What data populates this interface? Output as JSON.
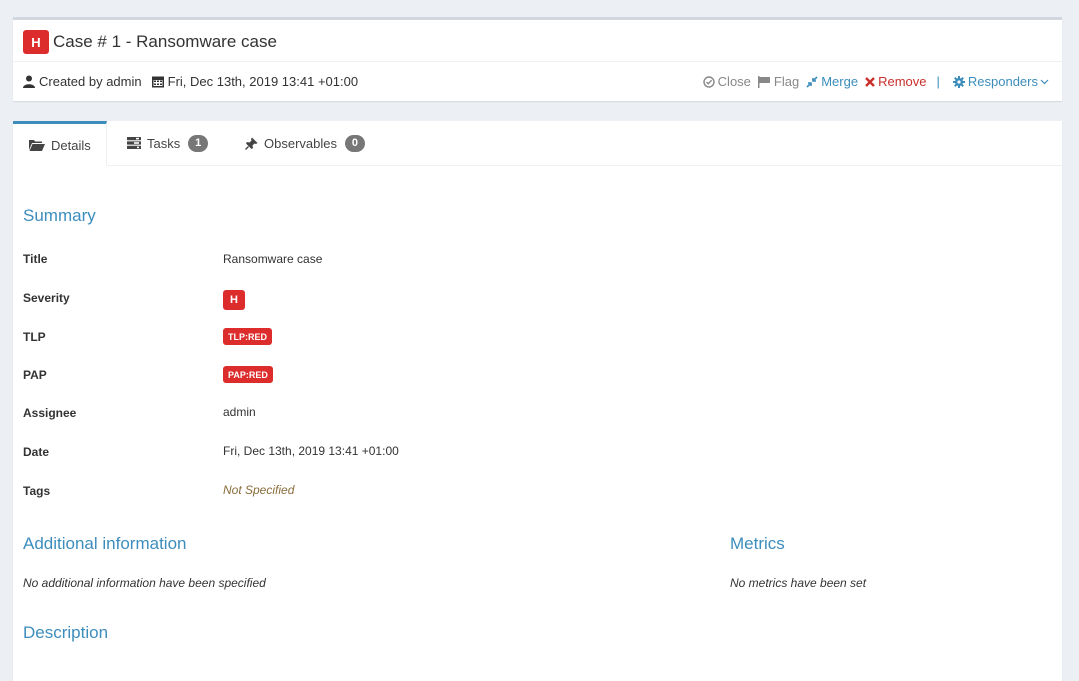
{
  "header": {
    "severity_letter": "H",
    "title": "Case # 1 - Ransomware case",
    "created_by": "Created by admin",
    "created_date": "Fri, Dec 13th, 2019 13:41 +01:00",
    "actions": {
      "close": "Close",
      "flag": "Flag",
      "merge": "Merge",
      "remove": "Remove",
      "responders": "Responders"
    }
  },
  "tabs": [
    {
      "label": "Details",
      "icon": "folder-open-icon"
    },
    {
      "label": "Tasks",
      "count": "1",
      "icon": "tasks-icon"
    },
    {
      "label": "Observables",
      "count": "0",
      "icon": "pin-icon"
    }
  ],
  "summary": {
    "heading": "Summary",
    "fields": {
      "title_label": "Title",
      "title_value": "Ransomware case",
      "severity_label": "Severity",
      "severity_value": "H",
      "tlp_label": "TLP",
      "tlp_value": "TLP:RED",
      "pap_label": "PAP",
      "pap_value": "PAP:RED",
      "assignee_label": "Assignee",
      "assignee_value": "admin",
      "date_label": "Date",
      "date_value": "Fri, Dec 13th, 2019 13:41 +01:00",
      "tags_label": "Tags",
      "tags_value": "Not Specified"
    }
  },
  "additional": {
    "heading": "Additional information",
    "empty_text": "No additional information have been specified"
  },
  "metrics": {
    "heading": "Metrics",
    "empty_text": "No metrics have been set"
  },
  "description": {
    "heading": "Description"
  },
  "colors": {
    "accent": "#3c8dbc",
    "danger": "#dd2c2c",
    "background": "#ecf0f5"
  }
}
